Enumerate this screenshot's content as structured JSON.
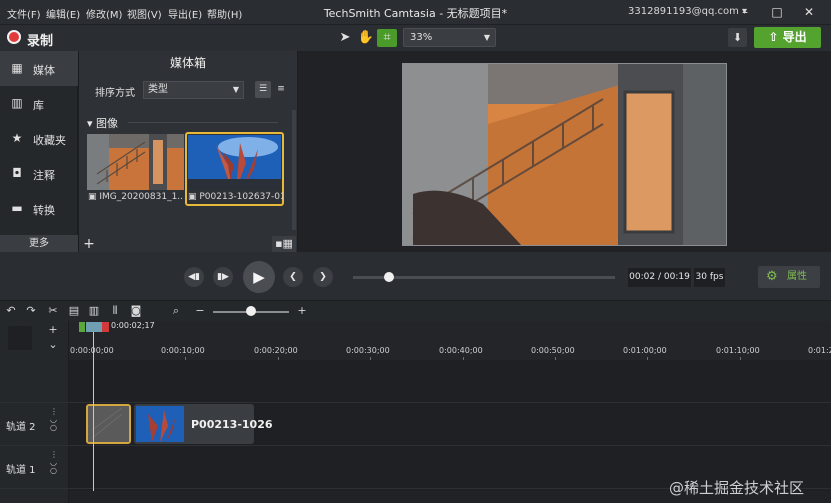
{
  "menu": [
    "文件(F)",
    "编辑(E)",
    "修改(M)",
    "视图(V)",
    "导出(E)",
    "帮助(H)"
  ],
  "window": {
    "title": "TechSmith Camtasia - 无标题项目*",
    "account": "3312891193@qq.com ▾",
    "min": "–",
    "max": "□",
    "close": "✕"
  },
  "toolbar": {
    "record": "录制",
    "zoom": "33%",
    "export": "导出"
  },
  "nav": {
    "items": [
      "媒体",
      "库",
      "收藏夹",
      "注释",
      "转换"
    ],
    "more": "更多"
  },
  "bin": {
    "title": "媒体箱",
    "sort_label": "排序方式",
    "sort_value": "类型",
    "group": "图像",
    "items": [
      {
        "label": "IMG_20200831_1..."
      },
      {
        "label": "P00213-102637-01..."
      }
    ]
  },
  "playback": {
    "time": "00:02 / 00:19",
    "fps": "30 fps",
    "properties": "属性"
  },
  "timeline": {
    "playhead_time": "0:00:02;17",
    "ticks": [
      "0:00:00;00",
      "0:00:10;00",
      "0:00:20;00",
      "0:00:30;00",
      "0:00:40;00",
      "0:00:50;00",
      "0:01:00;00",
      "0:01:10;00",
      "0:01:2"
    ],
    "tracks": [
      "轨道 2",
      "轨道 1"
    ],
    "clip2_label": "P00213-1026"
  },
  "watermark": "@稀土掘金技术社区",
  "colors": {
    "accent": "#54a32e",
    "selection": "#e6b93a",
    "record": "#e23b3b"
  }
}
